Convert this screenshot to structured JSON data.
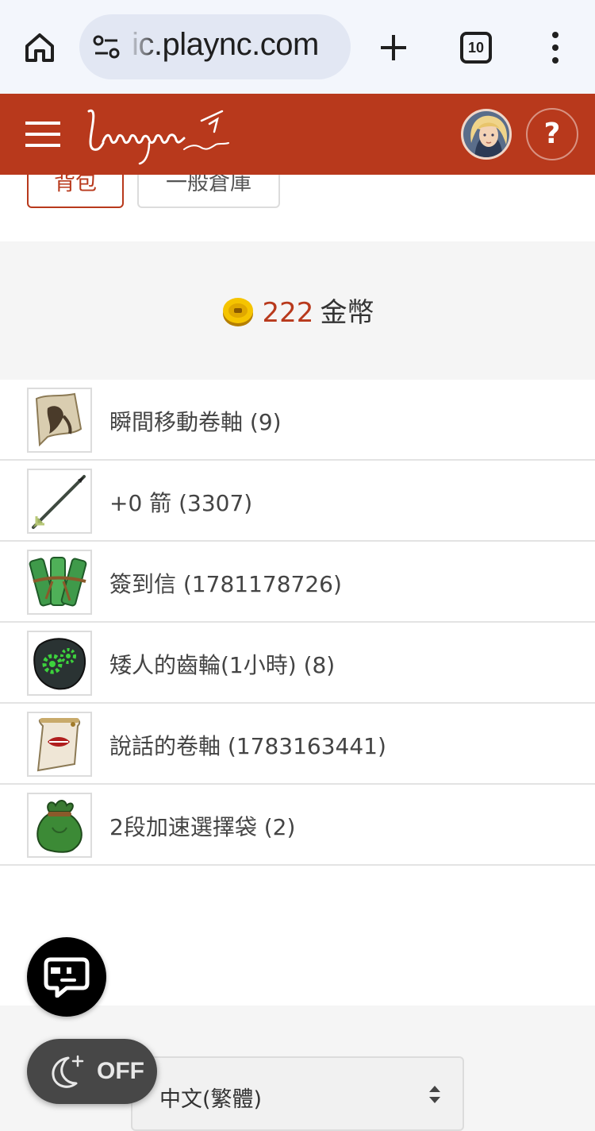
{
  "browser": {
    "url": "ic.plaync.com",
    "tab_count": "10"
  },
  "site": {
    "logo_text": "Lineage Classic",
    "help_label": "?"
  },
  "tabs": [
    {
      "label": "背包",
      "active": true
    },
    {
      "label": "一般倉庫",
      "active": false
    }
  ],
  "gold": {
    "amount": "222",
    "unit": "金幣"
  },
  "items": [
    {
      "name": "瞬間移動卷軸 (9)",
      "icon": "teleport-scroll-icon"
    },
    {
      "name": "+0 箭 (3307)",
      "icon": "arrow-icon"
    },
    {
      "name": "簽到信 (1781178726)",
      "icon": "attendance-letter-icon"
    },
    {
      "name": "矮人的齒輪(1小時) (8)",
      "icon": "dwarf-gear-icon"
    },
    {
      "name": "說話的卷軸 (1783163441)",
      "icon": "talking-scroll-icon"
    },
    {
      "name": "2段加速選擇袋 (2)",
      "icon": "haste-pouch-icon"
    }
  ],
  "footer": {
    "language": "中文(繁體)"
  },
  "dark_mode": {
    "label": "OFF"
  },
  "colors": {
    "brand": "#b8391c",
    "browser_bg": "#f3f6fc",
    "section_bg": "#f5f5f5"
  }
}
